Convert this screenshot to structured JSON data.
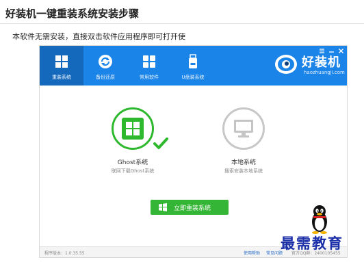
{
  "page": {
    "title": "好装机一键重装系统安装步骤",
    "intro": "本软件无需安装，直接双击软件应用程序即可打开使"
  },
  "app": {
    "nav": [
      {
        "label": "重装系统",
        "icon": "windows-icon",
        "active": true
      },
      {
        "label": "备份还原",
        "icon": "refresh-icon",
        "active": false
      },
      {
        "label": "常用软件",
        "icon": "apps-grid-icon",
        "active": false
      },
      {
        "label": "U盘装系统",
        "icon": "usb-icon",
        "active": false
      }
    ],
    "window_controls": [
      "settings-icon",
      "minimize-icon",
      "close-icon"
    ],
    "brand": {
      "name": "好装机",
      "url": "haozhuangji.com",
      "logo": "robot-eye-icon"
    },
    "modes": [
      {
        "title": "Ghost系统",
        "subtitle": "联网下载Ghost系统",
        "icon": "windows-icon",
        "selected": true
      },
      {
        "title": "本地系统",
        "subtitle": "搜索安装本地系统",
        "icon": "monitor-icon",
        "selected": false
      }
    ],
    "install_button": "立即重装系统",
    "footer": {
      "version": "程序版本：1.0.35.55",
      "links": [
        "使用帮助",
        "常见问题"
      ],
      "qq": "官方QQ群：2400105455"
    }
  },
  "watermark": "最需教育",
  "colors": {
    "header": "#1a84e8",
    "header_active": "#1569bd",
    "accent_green": "#35b535",
    "ghost_ring": "#2db82d",
    "local_ring": "#c7c7c7",
    "watermark": "#1b2fa8"
  }
}
